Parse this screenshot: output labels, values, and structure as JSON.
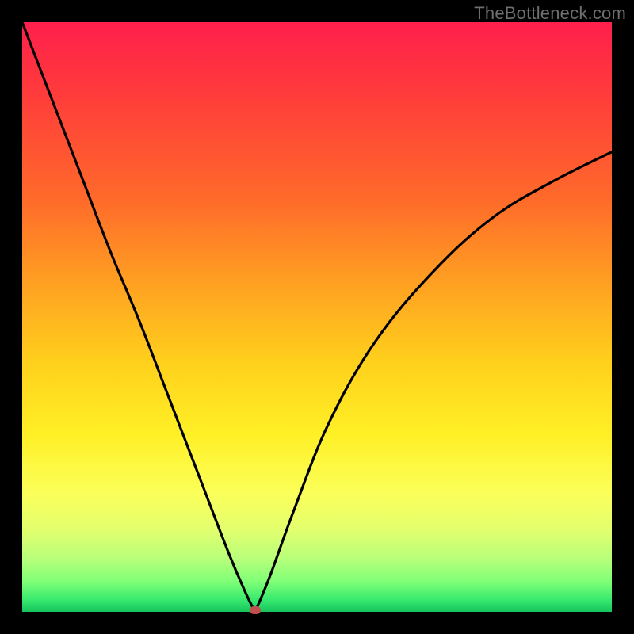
{
  "watermark": "TheBottleneck.com",
  "chart_data": {
    "type": "line",
    "title": "",
    "xlabel": "",
    "ylabel": "",
    "xlim": [
      0,
      1
    ],
    "ylim": [
      0,
      1
    ],
    "grid": false,
    "legend": false,
    "marker": {
      "x": 0.395,
      "y": 0.0
    },
    "series": [
      {
        "name": "curve",
        "x": [
          0.0,
          0.05,
          0.1,
          0.15,
          0.2,
          0.25,
          0.3,
          0.35,
          0.38,
          0.395,
          0.42,
          0.46,
          0.52,
          0.6,
          0.7,
          0.8,
          0.9,
          1.0
        ],
        "y": [
          1.0,
          0.87,
          0.74,
          0.61,
          0.49,
          0.36,
          0.23,
          0.1,
          0.03,
          0.0,
          0.06,
          0.17,
          0.32,
          0.46,
          0.58,
          0.67,
          0.73,
          0.78
        ]
      }
    ]
  }
}
